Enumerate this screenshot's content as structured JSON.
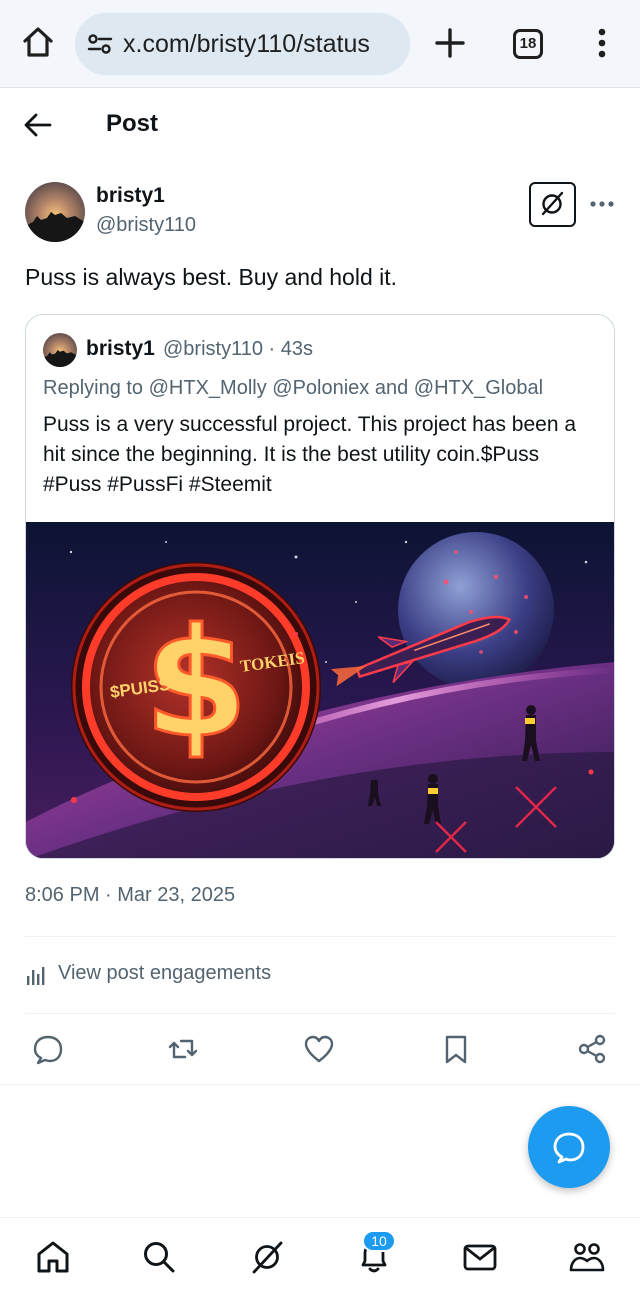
{
  "browser": {
    "url": "x.com/bristy110/status",
    "tab_count": "18"
  },
  "header": {
    "title": "Post"
  },
  "post": {
    "display_name": "bristy1",
    "handle": "@bristy110",
    "text": "Puss is always best. Buy and hold it.",
    "timestamp": "8:06 PM · Mar 23, 2025",
    "engagements_label": "View post engagements"
  },
  "quote": {
    "display_name": "bristy1",
    "handle_time": "@bristy110 · 43s",
    "replying_to": "Replying to @HTX_Molly @Poloniex and @HTX_Global",
    "text": "Puss is a very successful project. This project has been a hit since the beginning. It is the best utility coin.$Puss #Puss #PussFi #Steemit",
    "image": {
      "coin_left_text": "$PUISS",
      "coin_right_text": "TOKEIS"
    }
  },
  "actions": [
    "reply-icon",
    "repost-icon",
    "like-icon",
    "bookmark-icon",
    "share-icon"
  ],
  "bottom_nav": {
    "items": [
      "home-icon",
      "search-icon",
      "grok-icon",
      "notifications-icon",
      "messages-icon",
      "communities-icon"
    ],
    "notification_badge": "10"
  },
  "colors": {
    "accent": "#1d9bf0",
    "text_primary": "#0f1419",
    "text_secondary": "#536471"
  }
}
